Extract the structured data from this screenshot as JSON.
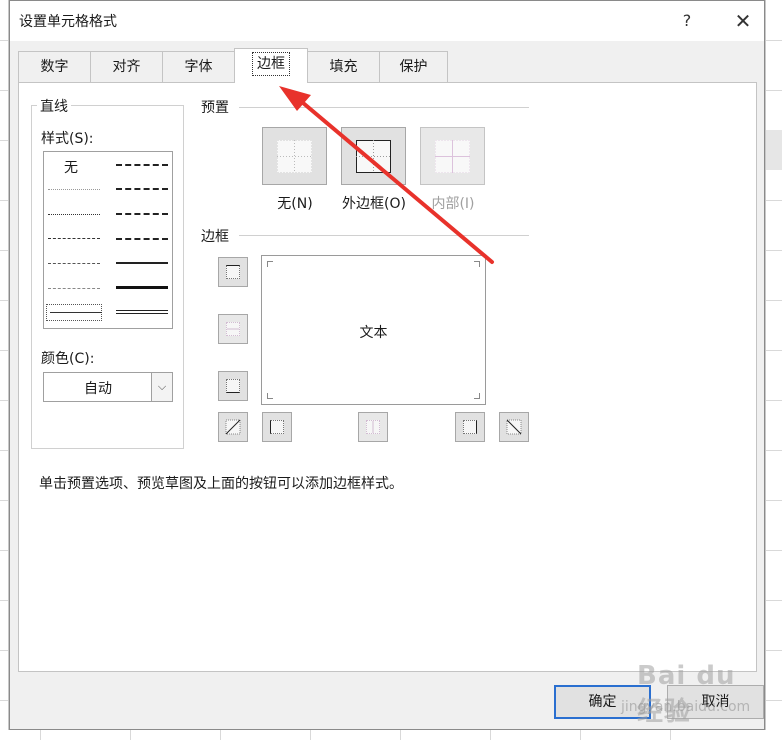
{
  "dialog": {
    "title": "设置单元格格式",
    "help_glyph": "?",
    "close_glyph": "✕"
  },
  "tabs": [
    {
      "label": "数字",
      "active": false
    },
    {
      "label": "对齐",
      "active": false
    },
    {
      "label": "字体",
      "active": false
    },
    {
      "label": "边框",
      "active": true
    },
    {
      "label": "填充",
      "active": false
    },
    {
      "label": "保护",
      "active": false
    }
  ],
  "line_group": {
    "title": "直线",
    "style_label": "样式(S):",
    "none_label": "无",
    "color_label": "颜色(C):",
    "color_value": "自动"
  },
  "presets": {
    "title": "预置",
    "items": [
      {
        "label": "无(N)",
        "enabled": true
      },
      {
        "label": "外边框(O)",
        "enabled": true
      },
      {
        "label": "内部(I)",
        "enabled": false
      }
    ]
  },
  "border": {
    "title": "边框",
    "preview_text": "文本"
  },
  "hint": "单击预置选项、预览草图及上面的按钮可以添加边框样式。",
  "buttons": {
    "ok": "确定",
    "cancel": "取消"
  },
  "watermark": {
    "text": "Bai du 经验",
    "url": "jingyan.baidu.com"
  },
  "colors": {
    "annotation_arrow": "#e8322b",
    "ok_border": "#2a6fd0"
  }
}
